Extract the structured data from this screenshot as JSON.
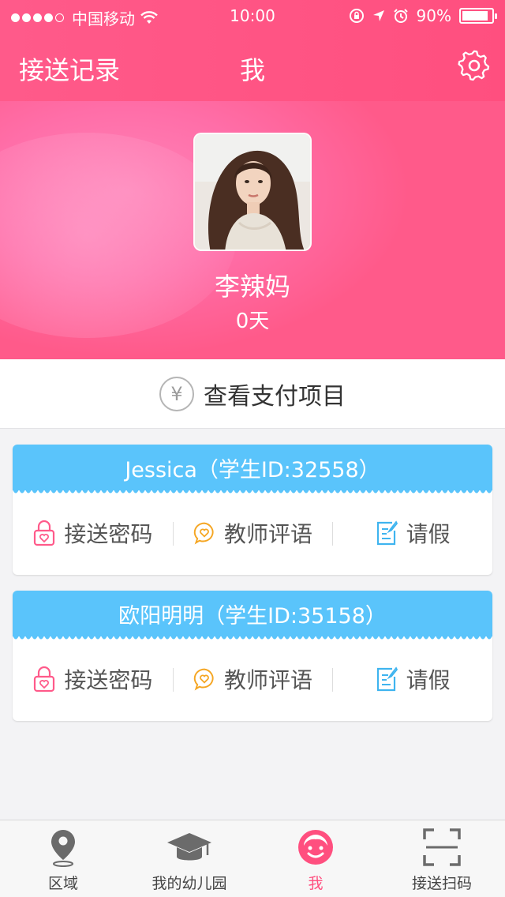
{
  "status_bar": {
    "carrier": "中国移动",
    "time": "10:00",
    "battery": "90%",
    "battery_level": 0.9
  },
  "nav": {
    "left_link": "接送记录",
    "title": "我",
    "settings_icon": "gear-icon"
  },
  "profile": {
    "name": "李辣妈",
    "days": "0天"
  },
  "payment": {
    "label": "查看支付项目",
    "icon": "yen-icon",
    "symbol": "¥"
  },
  "students": [
    {
      "title": "Jessica（学生ID:32558）",
      "actions": [
        {
          "label": "接送密码",
          "icon": "lock-heart-icon",
          "color": "#ff5a8a"
        },
        {
          "label": "教师评语",
          "icon": "chat-heart-icon",
          "color": "#f5a623"
        },
        {
          "label": "请假",
          "icon": "note-icon",
          "color": "#3fb4ef"
        }
      ]
    },
    {
      "title": "欧阳明明（学生ID:35158）",
      "actions": [
        {
          "label": "接送密码",
          "icon": "lock-heart-icon",
          "color": "#ff5a8a"
        },
        {
          "label": "教师评语",
          "icon": "chat-heart-icon",
          "color": "#f5a623"
        },
        {
          "label": "请假",
          "icon": "note-icon",
          "color": "#3fb4ef"
        }
      ]
    }
  ],
  "tabs": [
    {
      "label": "区域",
      "icon": "map-pin-icon",
      "active": false
    },
    {
      "label": "我的幼儿园",
      "icon": "graduation-cap-icon",
      "active": false
    },
    {
      "label": "我",
      "icon": "smiley-face-icon",
      "active": true
    },
    {
      "label": "接送扫码",
      "icon": "scan-icon",
      "active": false
    }
  ],
  "colors": {
    "brand_pink": "#ff4f7f",
    "card_blue": "#5ac4fb",
    "tab_inactive": "#6b6b6b"
  }
}
